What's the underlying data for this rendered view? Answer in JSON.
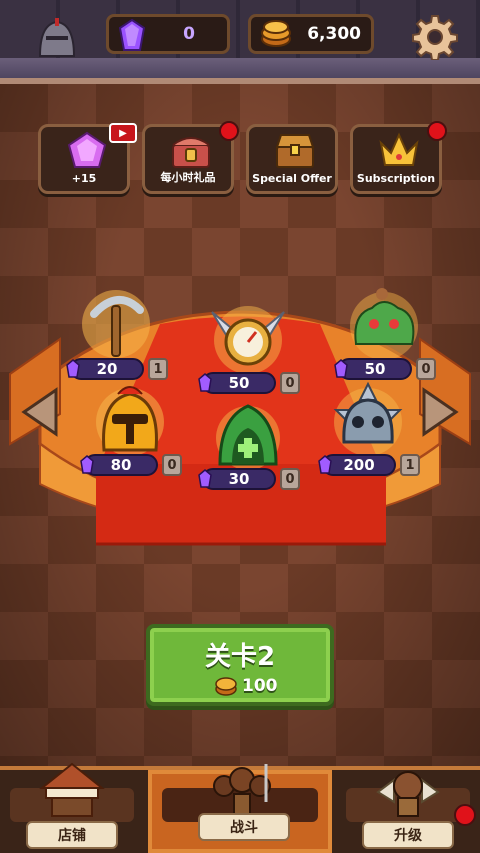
{
  "resources": {
    "gems": "0",
    "gold": "6,300"
  },
  "shop_buttons": [
    {
      "label": "+15",
      "icon": "gem-video-icon",
      "badge": false
    },
    {
      "label": "每小时礼品",
      "icon": "hourly-gift-chest-icon",
      "badge": true
    },
    {
      "label": "Special Offer",
      "icon": "treasure-chest-icon",
      "badge": false
    },
    {
      "label": "Subscription",
      "icon": "crown-icon",
      "badge": true
    }
  ],
  "items": [
    {
      "name": "pickaxe-hammer",
      "price": "20",
      "count": "1"
    },
    {
      "name": "compass-wings",
      "price": "50",
      "count": "0"
    },
    {
      "name": "green-slime-monster",
      "price": "50",
      "count": "0"
    },
    {
      "name": "golden-helmet",
      "price": "80",
      "count": "0"
    },
    {
      "name": "green-heal-hood",
      "price": "30",
      "count": "0"
    },
    {
      "name": "spiked-skull",
      "price": "200",
      "count": "1"
    }
  ],
  "level_button": {
    "title": "关卡2",
    "cost": "100"
  },
  "nav": [
    {
      "label": "店铺",
      "icon": "shop-tent-icon",
      "active": false,
      "badge": false
    },
    {
      "label": "战斗",
      "icon": "battle-warriors-icon",
      "active": true,
      "badge": false
    },
    {
      "label": "升级",
      "icon": "upgrade-hero-icon",
      "active": false,
      "badge": true
    }
  ],
  "colors": {
    "accent_green": "#6fb83a",
    "gem_purple": "#8a4ae8",
    "badge_red": "#e0121a",
    "active_tab": "#c96520"
  }
}
